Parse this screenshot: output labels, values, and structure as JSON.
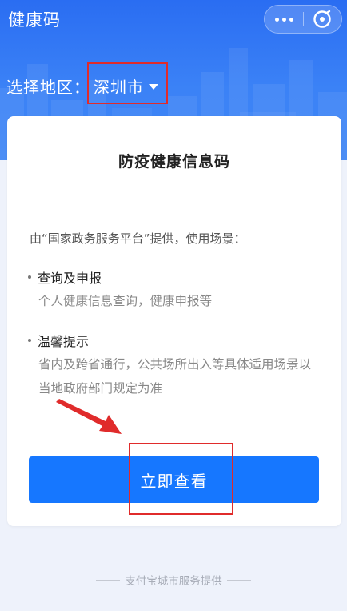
{
  "app": {
    "title": "健康码"
  },
  "region": {
    "label": "选择地区：",
    "value": "深圳市"
  },
  "card": {
    "title": "防疫健康信息码",
    "intro": "由“国家政务服务平台”提供，使用场景：",
    "sections": [
      {
        "heading": "查询及申报",
        "description": "个人健康信息查询，健康申报等"
      },
      {
        "heading": "温馨提示",
        "description": "省内及跨省通行，公共场所出入等具体适用场景以当地政府部门规定为准"
      }
    ],
    "button_label": "立即查看"
  },
  "footer": {
    "text": "支付宝城市服务提供"
  },
  "colors": {
    "header_blue": "#2a6df2",
    "button_blue": "#1677ff",
    "annotation_red": "#e02b2b",
    "page_background": "#eef2fb"
  },
  "icons": {
    "more": "more-dots-icon",
    "close": "close-circle-icon",
    "caret": "caret-down-icon",
    "arrow": "pointer-arrow-icon"
  }
}
